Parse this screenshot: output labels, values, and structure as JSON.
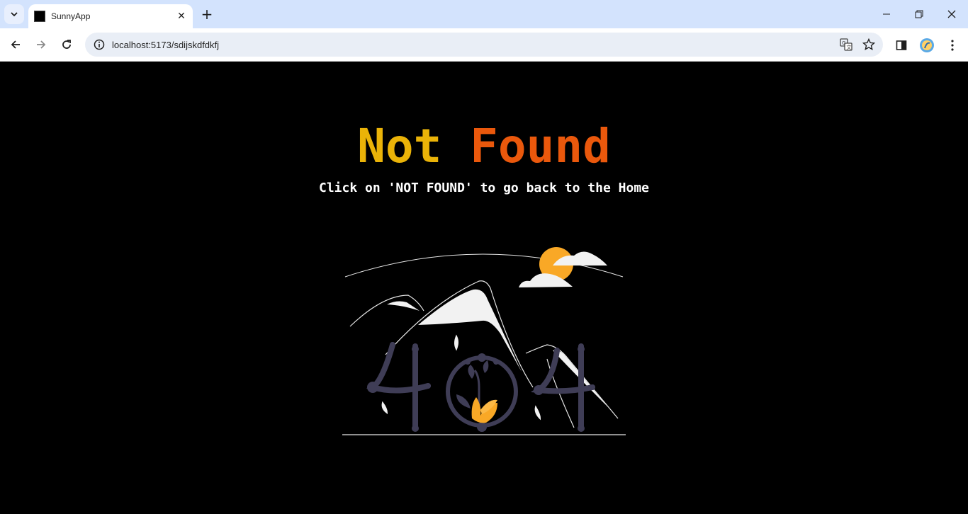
{
  "browser": {
    "tab_title": "SunnyApp",
    "url": "localhost:5173/sdijskdfdkfj",
    "new_tab_label": "+",
    "tab_close_label": "✕"
  },
  "page": {
    "headline_word1": "Not",
    "headline_word2": "Found",
    "subtitle": "Click on 'NOT FOUND' to go back to the Home",
    "colors": {
      "word1": "#eab308",
      "word2": "#ea580c",
      "background": "#000000",
      "sun": "#f9a826",
      "figure": "#3f3d56"
    }
  },
  "icons": [
    "tab-search-icon",
    "back-arrow-icon",
    "forward-arrow-icon",
    "reload-icon",
    "site-info-icon",
    "translate-icon",
    "bookmark-star-icon",
    "side-panel-icon",
    "profile-avatar-icon",
    "menu-kebab-icon",
    "minimize-icon",
    "restore-icon",
    "close-icon"
  ]
}
